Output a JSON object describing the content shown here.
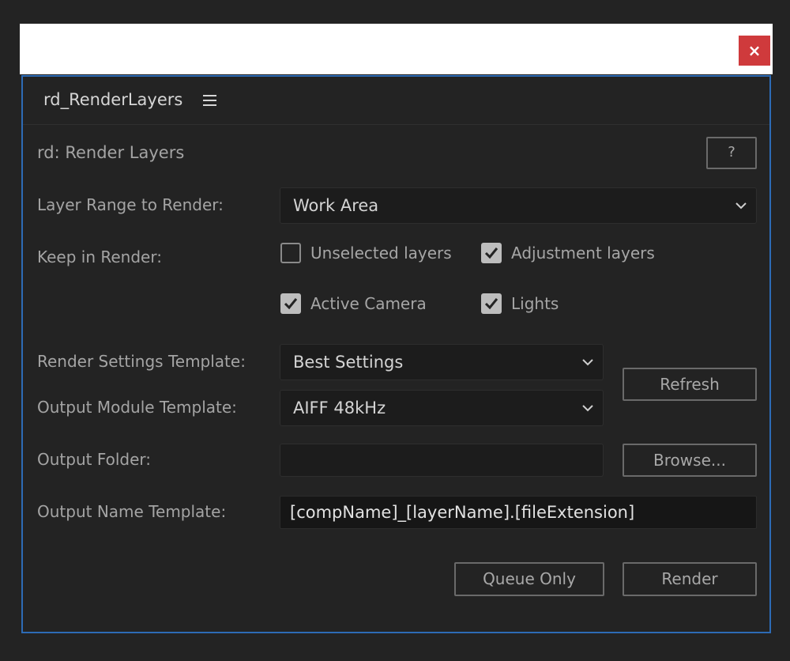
{
  "window": {
    "close_glyph": "×"
  },
  "panel": {
    "tab_label": "rd_RenderLayers",
    "title": "rd: Render Layers",
    "help_label": "?"
  },
  "layer_range": {
    "label": "Layer Range to Render:",
    "value": "Work Area"
  },
  "keep_in_render": {
    "label": "Keep in Render:",
    "options": [
      {
        "label": "Unselected layers",
        "checked": false
      },
      {
        "label": "Adjustment layers",
        "checked": true
      },
      {
        "label": "Active Camera",
        "checked": true
      },
      {
        "label": "Lights",
        "checked": true
      }
    ]
  },
  "render_settings": {
    "label": "Render Settings Template:",
    "value": "Best Settings"
  },
  "output_module": {
    "label": "Output Module Template:",
    "value": "AIFF 48kHz"
  },
  "refresh_label": "Refresh",
  "output_folder": {
    "label": "Output Folder:",
    "value": "",
    "browse_label": "Browse..."
  },
  "output_name": {
    "label": "Output Name Template:",
    "value": "[compName]_[layerName].[fileExtension]"
  },
  "actions": {
    "queue_label": "Queue Only",
    "render_label": "Render"
  }
}
